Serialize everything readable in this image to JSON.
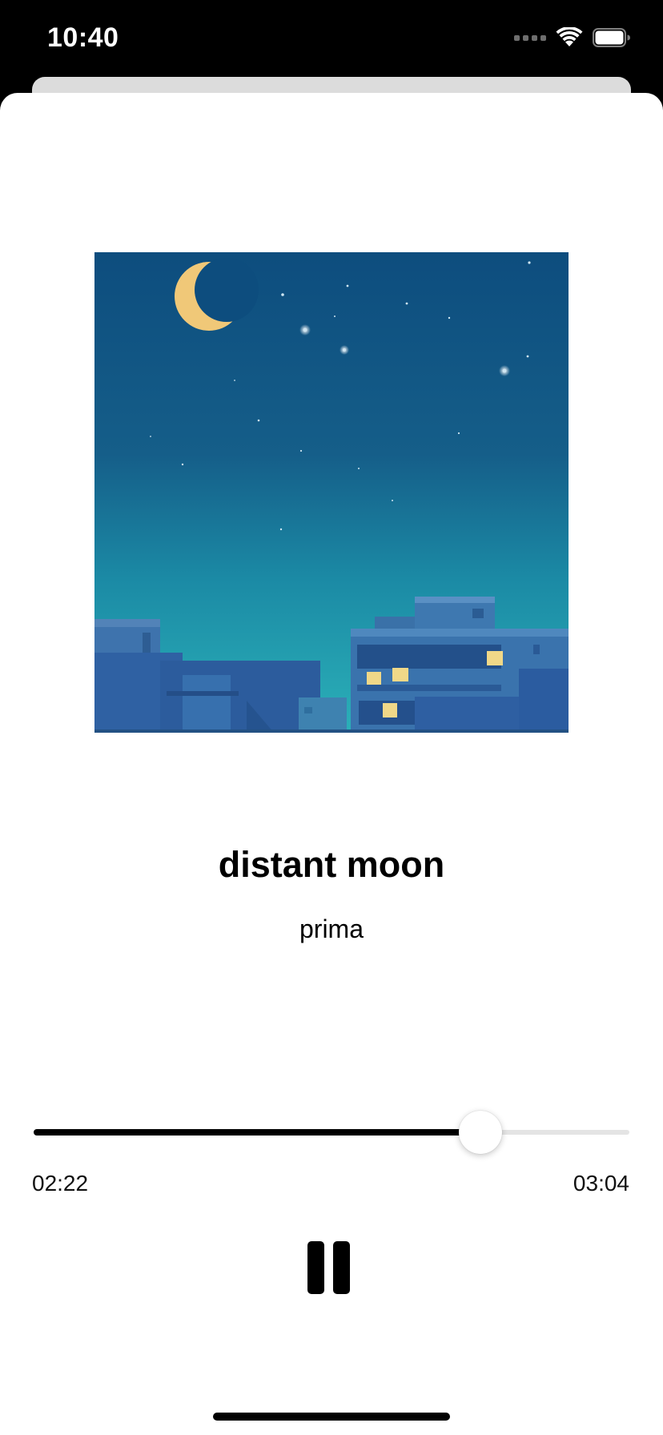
{
  "status_bar": {
    "time": "10:40",
    "icons": [
      "cellular-signal-icon",
      "wifi-icon",
      "battery-icon"
    ]
  },
  "now_playing": {
    "artwork": {
      "description_icon": "album-artwork"
    },
    "title": "distant moon",
    "artist": "prima"
  },
  "playback": {
    "elapsed": "02:22",
    "total": "03:04",
    "progress_fraction": 0.75,
    "control": "pause-icon"
  },
  "colors": {
    "accent": "#000000",
    "track": "#e4e4e4",
    "background": "#ffffff"
  }
}
